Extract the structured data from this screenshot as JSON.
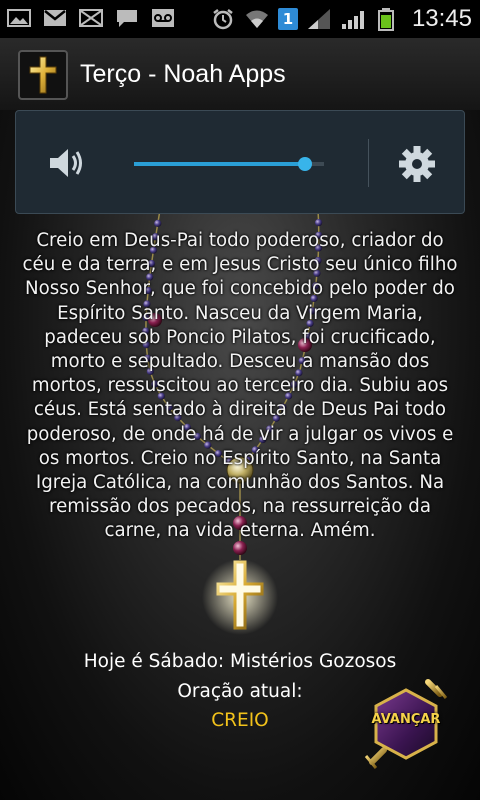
{
  "status_bar": {
    "time": "13:45",
    "notification_count": "1",
    "icons": [
      "gallery-icon",
      "gmail-icon",
      "missed-message-icon",
      "chat-icon",
      "voicemail-icon",
      "alarm-icon",
      "wifi-icon",
      "signal-icon",
      "battery-icon"
    ]
  },
  "app_bar": {
    "title": "Terço - Noah Apps"
  },
  "volume_panel": {
    "level": 0.9
  },
  "prayer_text": "Creio em Deus-Pai todo poderoso, criador do céu e da terra, e em Jesus Cristo seu único filho Nosso Senhor, que foi concebido pelo poder do Espírito Santo. Nasceu da Virgem Maria, padeceu sob Poncio Pilatos, foi crucificado, morto e sepultado. Desceu a mansão dos mortos, ressuscitou ao terceiro dia. Subiu aos céus. Está sentado à direita de Deus Pai todo poderoso, de onde há de vir a julgar os vivos e os mortos. Creio no Espírito Santo, na Santa Igreja Católica, na comunhão dos Santos. Na remissão dos pecados, na ressurreição da carne, na vida eterna. Amém.",
  "footer": {
    "day_line": "Hoje é Sábado: Mistérios Gozosos",
    "current_label": "Oração atual:",
    "current_prayer": "CREIO",
    "advance_label": "AVANÇAR"
  },
  "colors": {
    "accent_blue": "#2a9fd6",
    "current_prayer": "#f2c21b"
  }
}
